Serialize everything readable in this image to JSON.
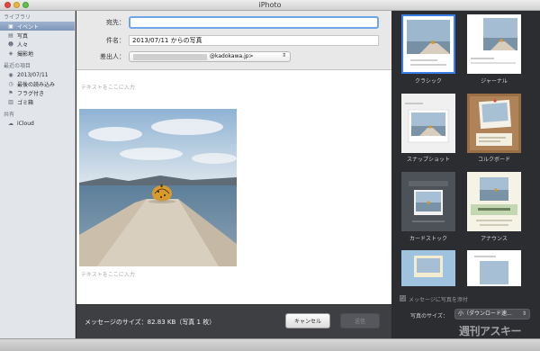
{
  "window": {
    "title": "iPhoto"
  },
  "sidebar": {
    "sections": [
      {
        "header": "ライブラリ",
        "items": [
          {
            "label": "イベント",
            "icon": "events-icon",
            "selected": true
          },
          {
            "label": "写真",
            "icon": "photos-icon"
          },
          {
            "label": "人々",
            "icon": "people-icon"
          },
          {
            "label": "撮影地",
            "icon": "places-icon"
          }
        ]
      },
      {
        "header": "最近の項目",
        "items": [
          {
            "label": "2013/07/11",
            "icon": "event-icon"
          },
          {
            "label": "最後の読み込み",
            "icon": "import-icon"
          },
          {
            "label": "フラグ付き",
            "icon": "flag-icon"
          },
          {
            "label": "ゴミ箱",
            "icon": "trash-icon"
          }
        ]
      },
      {
        "header": "共有",
        "items": [
          {
            "label": "iCloud",
            "icon": "cloud-icon"
          }
        ]
      }
    ]
  },
  "compose": {
    "to_label": "宛先：",
    "to_value": "",
    "subject_label": "件名：",
    "subject_value": "2013/07/11 からの写真",
    "from_label": "差出人：",
    "from_value": "@kadokawa.jp>",
    "text_placeholder_top": "テキストをここに入力",
    "text_placeholder_bottom": "テキストをここに入力"
  },
  "footer": {
    "message_size": "メッセージのサイズ：82.83 KB（写真 1 枚）",
    "cancel_label": "キャンセル",
    "send_label": "送信"
  },
  "themes": [
    {
      "label": "クラシック",
      "selected": true
    },
    {
      "label": "ジャーナル"
    },
    {
      "label": "スナップショット"
    },
    {
      "label": "コルクボード"
    },
    {
      "label": "カードストック"
    },
    {
      "label": "アナウンス"
    }
  ],
  "options": {
    "attach_label": "メッセージに写真を添付",
    "attach_checked": true,
    "photo_size_label": "写真のサイズ：",
    "photo_size_value": "小（ダウンロード速..."
  },
  "watermark": "週刊アスキー",
  "colors": {
    "accent": "#3a7fe6",
    "panel": "#2b2d31",
    "footer": "#3d3f43"
  }
}
